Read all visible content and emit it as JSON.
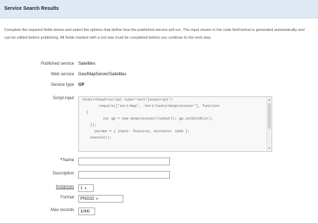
{
  "header": {
    "title": "Service Search Results"
  },
  "description": "Complete the required fields below and select the options that define how the published service will run. The input shown in the code field below is generated automatically and can be edited before publishing. All fields marked with a red star must be completed before you continue to the next step.",
  "form": {
    "rows": [
      {
        "label": "Published service",
        "value": "Satellites",
        "kind": "text"
      },
      {
        "label": "Web service",
        "value": "Geo/MapServer/Satellites",
        "kind": "text"
      },
      {
        "label": "Service type",
        "value": "GP",
        "kind": "bold"
      }
    ],
    "code": {
      "label": "Script input",
      "lines": [
        "<html><head><script type='text/javascript'>",
        "        require(['esri/map', 'esri/tasks/Geoprocessor'], function",
        "  {",
        "          var gp = new Geoprocessor(taskUrl); gp.setOutSR(sr);",
        "    });",
        "      params = { input: features, distance: 1000 };",
        "    execute();"
      ]
    },
    "name": {
      "label": "Name",
      "required": true,
      "value": ""
    },
    "description": {
      "label": "Description",
      "value": ""
    },
    "instances": {
      "label": "Instances",
      "value": "1"
    },
    "format": {
      "label": "Format",
      "selected": "PNG32"
    },
    "max_records": {
      "label": "Max records",
      "value": "1000"
    }
  },
  "icons": {
    "scroll_up": "scroll-up-arrow",
    "scroll_down": "scroll-down-arrow",
    "dropdown": "chevron-down"
  },
  "colors": {
    "header_bg": "#dfe9f4",
    "required_star": "#d00000"
  }
}
